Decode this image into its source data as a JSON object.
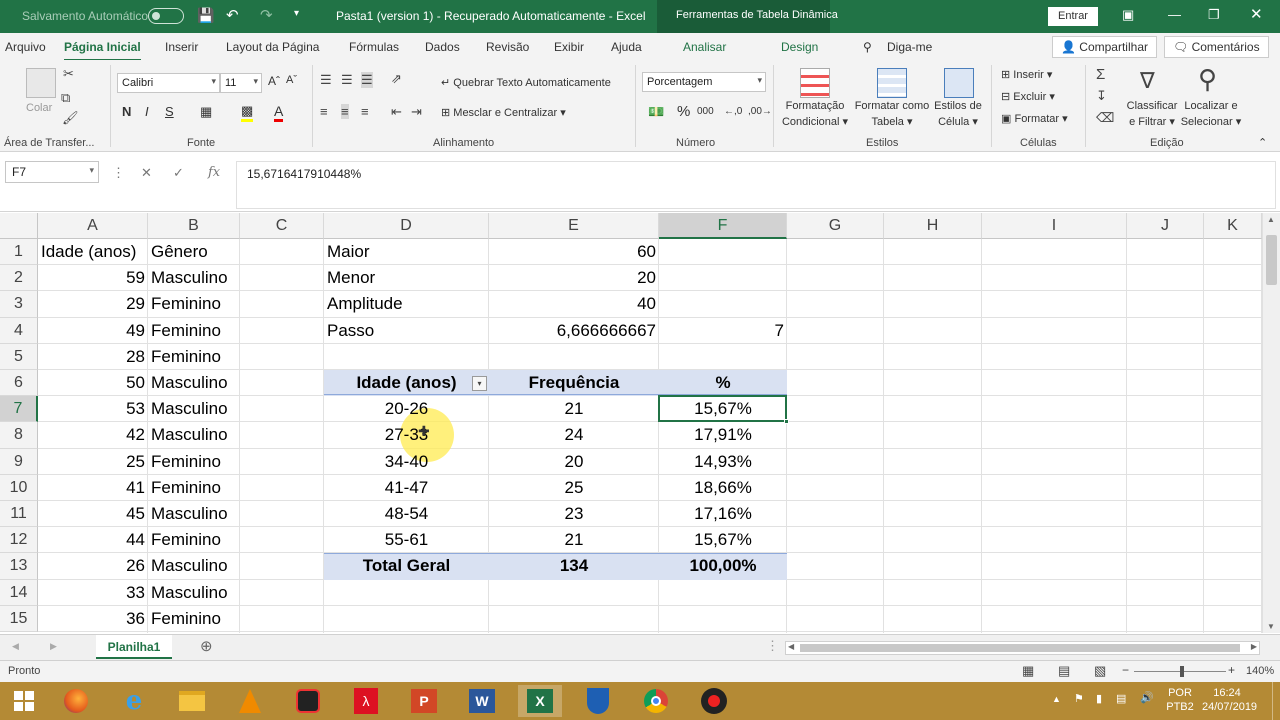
{
  "title_bar": {
    "autosave": "Salvamento Automático",
    "doc_title": "Pasta1 (version 1)  -  Recuperado Automaticamente  -  Excel",
    "context_tools": "Ferramentas de Tabela Dinâmica",
    "signin": "Entrar"
  },
  "ribbon_tabs": [
    "Arquivo",
    "Página Inicial",
    "Inserir",
    "Layout da Página",
    "Fórmulas",
    "Dados",
    "Revisão",
    "Exibir",
    "Ajuda",
    "Analisar",
    "Design"
  ],
  "tell_me": "Diga-me",
  "share": "Compartilhar",
  "comments": "Comentários",
  "ribbon": {
    "clipboard": {
      "paste": "Colar",
      "label": "Área de Transfer..."
    },
    "font": {
      "name": "Calibri",
      "size": "11",
      "label": "Fonte"
    },
    "alignment": {
      "wrap": "Quebrar Texto Automaticamente",
      "merge": "Mesclar e Centralizar",
      "label": "Alinhamento"
    },
    "number": {
      "format": "Porcentagem",
      "label": "Número"
    },
    "styles": {
      "cond_1": "Formatação",
      "cond_2": "Condicional",
      "table_1": "Formatar como",
      "table_2": "Tabela",
      "cell_1": "Estilos de",
      "cell_2": "Célula",
      "label": "Estilos"
    },
    "cells": {
      "insert": "Inserir",
      "delete": "Excluir",
      "format": "Formatar",
      "label": "Células"
    },
    "editing": {
      "sort_1": "Classificar",
      "sort_2": "e Filtrar",
      "find_1": "Localizar e",
      "find_2": "Selecionar",
      "label": "Edição"
    }
  },
  "formula_bar": {
    "name_box": "F7",
    "formula": "15,6716417910448%"
  },
  "columns": [
    "A",
    "B",
    "C",
    "D",
    "E",
    "F",
    "G",
    "H",
    "I",
    "J",
    "K"
  ],
  "rows": [
    "1",
    "2",
    "3",
    "4",
    "5",
    "6",
    "7",
    "8",
    "9",
    "10",
    "11",
    "12",
    "13",
    "14",
    "15"
  ],
  "cells": {
    "A1": "Idade (anos)",
    "B1": "Gênero",
    "A2": "59",
    "B2": "Masculino",
    "A3": "29",
    "B3": "Feminino",
    "A4": "49",
    "B4": "Feminino",
    "A5": "28",
    "B5": "Feminino",
    "A6": "50",
    "B6": "Masculino",
    "A7": "53",
    "B7": "Masculino",
    "A8": "42",
    "B8": "Masculino",
    "A9": "25",
    "B9": "Feminino",
    "A10": "41",
    "B10": "Feminino",
    "A11": "45",
    "B11": "Masculino",
    "A12": "44",
    "B12": "Feminino",
    "A13": "26",
    "B13": "Masculino",
    "A14": "33",
    "B14": "Masculino",
    "A15": "36",
    "B15": "Feminino",
    "D1": "Maior",
    "E1": "60",
    "D2": "Menor",
    "E2": "20",
    "D3": "Amplitude",
    "E3": "40",
    "D4": "Passo",
    "E4": "6,666666667",
    "F4": "7"
  },
  "pivot": {
    "headers": [
      "Idade (anos)",
      "Frequência",
      "%"
    ],
    "rows": [
      [
        "20-26",
        "21",
        "15,67%"
      ],
      [
        "27-33",
        "24",
        "17,91%"
      ],
      [
        "34-40",
        "20",
        "14,93%"
      ],
      [
        "41-47",
        "25",
        "18,66%"
      ],
      [
        "48-54",
        "23",
        "17,16%"
      ],
      [
        "55-61",
        "21",
        "15,67%"
      ]
    ],
    "total": [
      "Total Geral",
      "134",
      "100,00%"
    ]
  },
  "sheet_tab": "Planilha1",
  "status": {
    "ready": "Pronto",
    "zoom": "140%"
  },
  "taskbar": {
    "lang_1": "POR",
    "lang_2": "PTB2",
    "time": "16:24",
    "date": "24/07/2019"
  },
  "colors": {
    "excel_green": "#217346",
    "pivot_band": "#d9e1f2",
    "taskbar": "#b48a35"
  }
}
